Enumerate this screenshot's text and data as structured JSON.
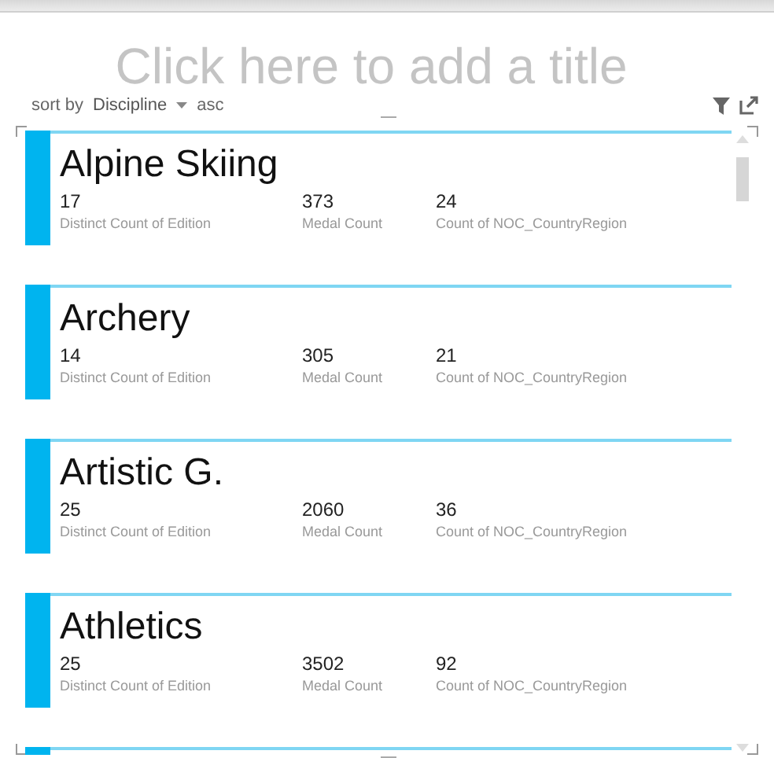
{
  "title_placeholder": "Click here to add a title",
  "sort": {
    "label": "sort by",
    "field": "Discipline",
    "order": "asc"
  },
  "cards": [
    {
      "name": "Alpine Skiing",
      "metrics": [
        {
          "value": "17",
          "label": "Distinct Count of Edition"
        },
        {
          "value": "373",
          "label": "Medal Count"
        },
        {
          "value": "24",
          "label": "Count of NOC_CountryRegion"
        }
      ]
    },
    {
      "name": "Archery",
      "metrics": [
        {
          "value": "14",
          "label": "Distinct Count of Edition"
        },
        {
          "value": "305",
          "label": "Medal Count"
        },
        {
          "value": "21",
          "label": "Count of NOC_CountryRegion"
        }
      ]
    },
    {
      "name": "Artistic G.",
      "metrics": [
        {
          "value": "25",
          "label": "Distinct Count of Edition"
        },
        {
          "value": "2060",
          "label": "Medal Count"
        },
        {
          "value": "36",
          "label": "Count of NOC_CountryRegion"
        }
      ]
    },
    {
      "name": "Athletics",
      "metrics": [
        {
          "value": "25",
          "label": "Distinct Count of Edition"
        },
        {
          "value": "3502",
          "label": "Medal Count"
        },
        {
          "value": "92",
          "label": "Count of NOC_CountryRegion"
        }
      ]
    }
  ]
}
